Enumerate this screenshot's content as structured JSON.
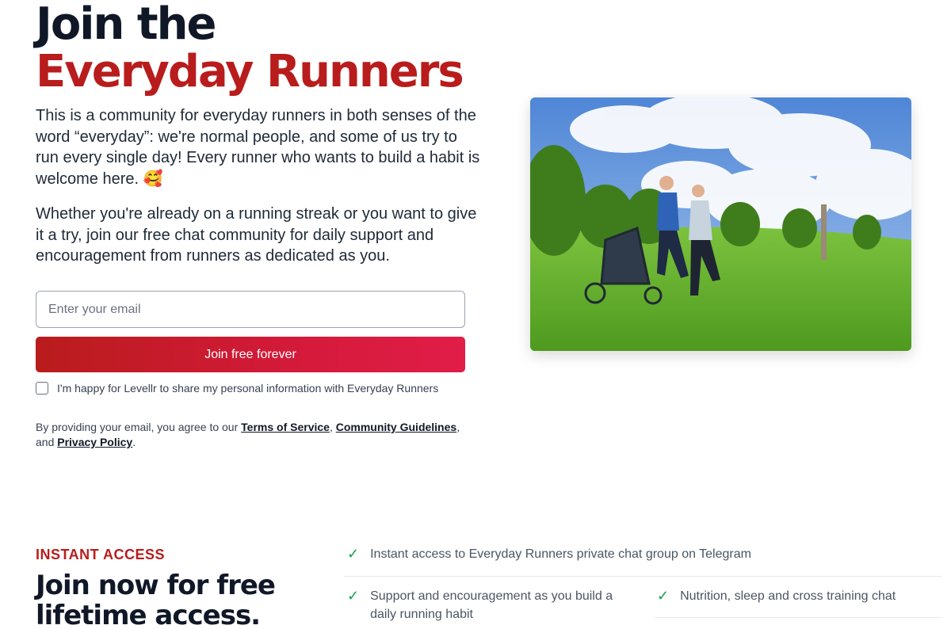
{
  "hero": {
    "title_line1": "Join the",
    "title_line2": "Everyday Runners",
    "paragraph1": "This is a community for everyday runners in both senses of the word “everyday”: we're normal people, and some of us try to run every single day! Every runner who wants to build a habit is welcome here. 🥰",
    "paragraph2": "Whether you're already on a running streak or you want to give it a try, join our free chat community for daily support and encouragement from runners as dedicated as you."
  },
  "form": {
    "email_placeholder": "Enter your email",
    "email_value": "",
    "submit_label": "Join free forever",
    "consent_label": "I'm happy for Levellr to share my personal information with Everyday Runners",
    "consent_checked": false
  },
  "legal": {
    "prefix": "By providing your email, you agree to our ",
    "terms": "Terms of Service",
    "sep1": ", ",
    "guidelines": "Community Guidelines",
    "sep2": ",",
    "and": " and ",
    "privacy": "Privacy Policy",
    "suffix": "."
  },
  "image": {
    "alt": ""
  },
  "access": {
    "eyebrow": "INSTANT ACCESS",
    "title": "Join now for free lifetime access.",
    "features": [
      "Instant access to Everyday Runners private chat group on Telegram",
      "Support and encouragement as you build a daily running habit",
      "Nutrition, sleep and cross training chat"
    ]
  },
  "colors": {
    "brand_red": "#b91c1c",
    "button_gradient_end": "#e11d48",
    "check_green": "#16a34a",
    "heading_dark": "#101828"
  },
  "icons": {
    "feature_check": "check-icon"
  }
}
